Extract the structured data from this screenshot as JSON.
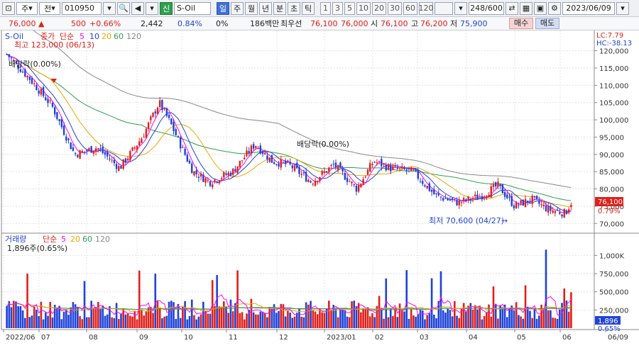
{
  "toolbar": {
    "market": "주",
    "board": "전",
    "code": "010950",
    "credit_badge": "신",
    "name": "S-Oil",
    "periods": [
      "일",
      "주",
      "월",
      "년",
      "분",
      "초",
      "틱"
    ],
    "active_period": "일",
    "intervals": [
      "1",
      "3",
      "5",
      "10",
      "20",
      "30",
      "60",
      "120"
    ],
    "count": "248/600",
    "date": "2023/06/09"
  },
  "quote": {
    "price": "76,000",
    "change": "500",
    "change_pct": "+0.66%",
    "volume": "2,442",
    "volume_pct": "0.84%",
    "market_pct": "0%",
    "amount": "186백만",
    "best_bid_label": "최우선",
    "best_bid": "76,100",
    "best_ask": "76,000",
    "open_label": "시",
    "open": "76,100",
    "high_label": "고",
    "high": "76,200",
    "low_label": "저",
    "low": "75,900",
    "buy_label": "매수",
    "sell_label": "매도"
  },
  "price_panel": {
    "legend_name": "S-Oil",
    "legend_close": "종가",
    "legend_ma": "단순",
    "ma_periods": [
      "5",
      "10",
      "20",
      "60",
      "120"
    ],
    "high_note": "최고 123,000 (06/13)",
    "low_note": "최저 70,600 (04/27)",
    "div_note": "배당락(0.00%)",
    "lc_label": "LC:7.79",
    "hc_label": "HC:-38.13",
    "current_tag": "76,100",
    "current_pct": "0.79%"
  },
  "volume_panel": {
    "legend_name": "거래량",
    "legend_ma": "단순",
    "ma_periods": [
      "5",
      "20",
      "60",
      "120"
    ],
    "note": "1,896주(0.65%)",
    "current_tag": "1,896",
    "current_pct": "0.65%"
  },
  "x_axis": {
    "labels": [
      "2022/06",
      "07",
      "08",
      "09",
      "10",
      "11",
      "12",
      "2023/01",
      "02",
      "03",
      "04",
      "05",
      "06",
      "06/09"
    ]
  },
  "colors": {
    "up": "#e0201b",
    "down": "#1f43d8",
    "ma5": "#ff00ff",
    "ma10": "#1f43d8",
    "ma20": "#e8a800",
    "ma60": "#2e9e4f",
    "ma120": "#888888"
  },
  "chart_data": [
    {
      "type": "candlestick",
      "title": "S-Oil",
      "y_ticks": [
        "120,000",
        "115,000",
        "110,000",
        "105,000",
        "100,000",
        "95,000",
        "90,000",
        "85,000",
        "80,000",
        "75,000",
        "70,000"
      ],
      "ylim": [
        68000,
        123000
      ],
      "series": [
        {
          "name": "종가",
          "values_approx": [
            [
              0,
              119000
            ],
            [
              4,
              112000
            ],
            [
              8,
              104000
            ],
            [
              12,
              90000
            ],
            [
              16,
              92000
            ],
            [
              20,
              86000
            ],
            [
              24,
              95000
            ],
            [
              27,
              105000
            ],
            [
              29,
              99000
            ],
            [
              33,
              85000
            ],
            [
              36,
              82000
            ],
            [
              40,
              85000
            ],
            [
              44,
              93000
            ],
            [
              47,
              88000
            ],
            [
              50,
              87000
            ],
            [
              54,
              82000
            ],
            [
              58,
              87000
            ],
            [
              62,
              80000
            ],
            [
              65,
              88000
            ],
            [
              68,
              86000
            ],
            [
              72,
              85000
            ],
            [
              76,
              78000
            ],
            [
              80,
              76000
            ],
            [
              84,
              78000
            ],
            [
              87,
              81000
            ],
            [
              90,
              75000
            ],
            [
              93,
              77000
            ],
            [
              96,
              74000
            ],
            [
              99,
              73000
            ],
            [
              100,
              76100
            ]
          ]
        }
      ]
    },
    {
      "type": "bar",
      "title": "거래량",
      "y_ticks": [
        "1,000K",
        "750,000",
        "500,000",
        "250,000"
      ],
      "ylim": [
        0,
        1150000
      ]
    }
  ]
}
